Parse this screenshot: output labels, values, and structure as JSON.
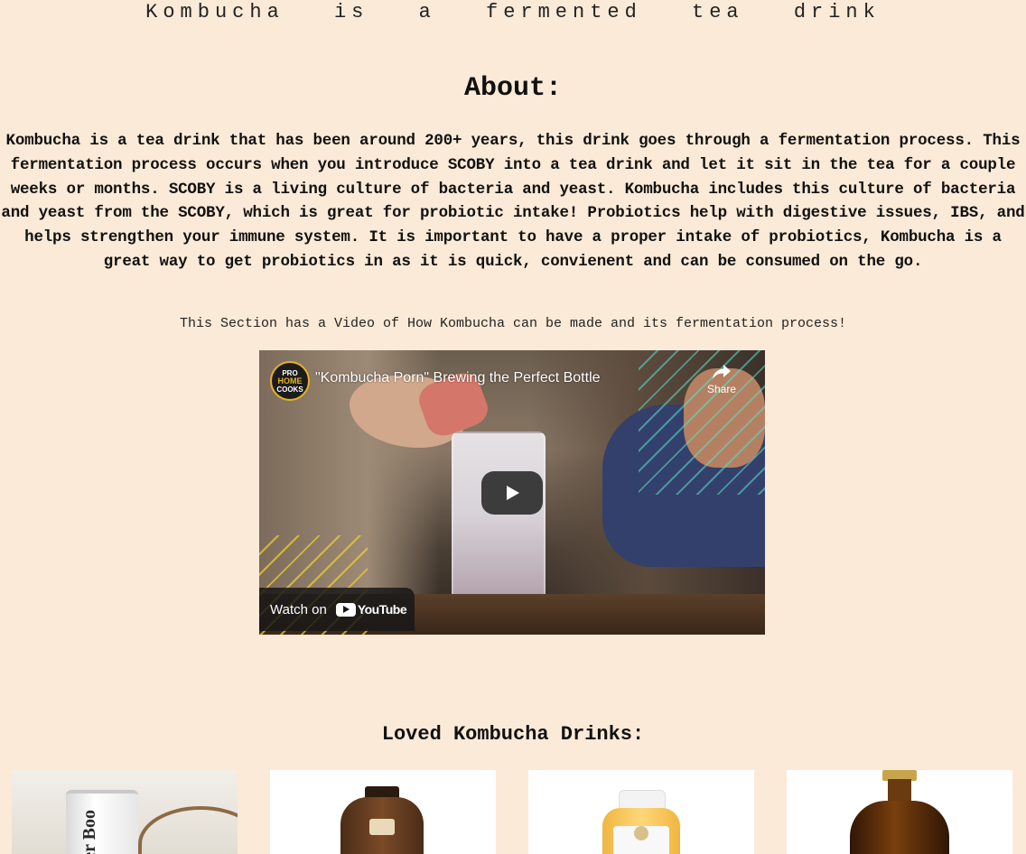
{
  "header": {
    "tagline": "Kombucha is a fermented tea drink"
  },
  "about": {
    "title": "About:",
    "body": "Kombucha is a tea drink that has been around 200+ years, this drink goes through a fermentation process. This fermentation process occurs when you introduce SCOBY into a tea drink and let it sit in the tea for a couple weeks or months. SCOBY is a living culture of bacteria and yeast. Kombucha includes this culture of bacteria and yeast from the SCOBY, which is great for probiotic intake! Probiotics help with digestive issues, IBS, and helps strengthen your immune system. It is important to have a proper intake of probiotics, Kombucha is a great way to get probiotics in as it is quick, convienent and can be consumed on the go."
  },
  "video_section": {
    "caption": "This Section has a Video of How Kombucha can be made and its fermentation process!",
    "video": {
      "title": "\"Kombucha Porn\" Brewing the Perfect Bottle",
      "share_label": "Share",
      "watch_on_label": "Watch on",
      "platform_label": "YouTube",
      "channel_logo": {
        "line1": "PRO",
        "line2": "HOME",
        "line3": "COOKS"
      },
      "icons": {
        "play": "play-icon",
        "share": "share-icon"
      }
    }
  },
  "loved_drinks": {
    "title": "Loved Kombucha Drinks:",
    "products": [
      {
        "name": "product-1",
        "can_text": "tter\nBoo"
      },
      {
        "name": "product-2"
      },
      {
        "name": "product-3"
      },
      {
        "name": "product-4"
      }
    ]
  },
  "colors": {
    "background": "#faead7",
    "text": "#111111"
  }
}
